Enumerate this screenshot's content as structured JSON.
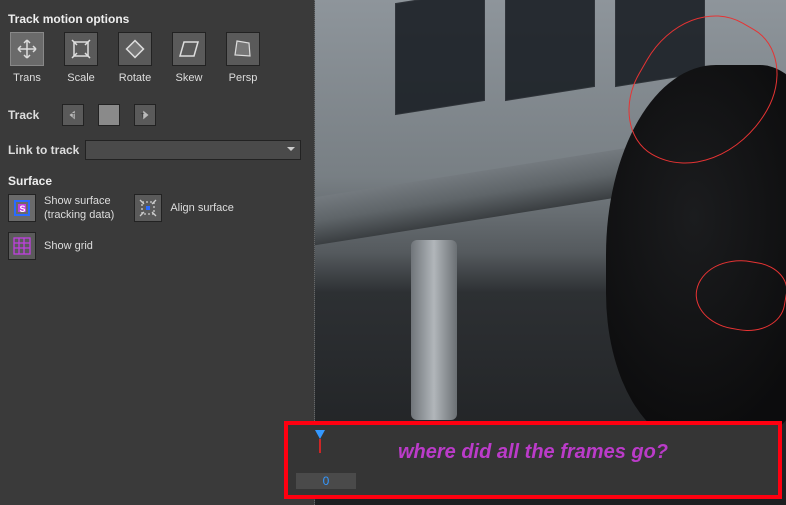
{
  "sections": {
    "motion_title": "Track motion options",
    "surface_title": "Surface"
  },
  "motion_options": {
    "trans": "Trans",
    "scale": "Scale",
    "rotate": "Rotate",
    "skew": "Skew",
    "persp": "Persp"
  },
  "track": {
    "label": "Track"
  },
  "link": {
    "label": "Link to track",
    "value": ""
  },
  "surface": {
    "show_surface_1": "Show surface",
    "show_surface_2": "(tracking data)",
    "align_surface": "Align surface",
    "show_grid": "Show grid"
  },
  "annotation": {
    "text": "where did all the frames go?",
    "frame_number": "0"
  }
}
